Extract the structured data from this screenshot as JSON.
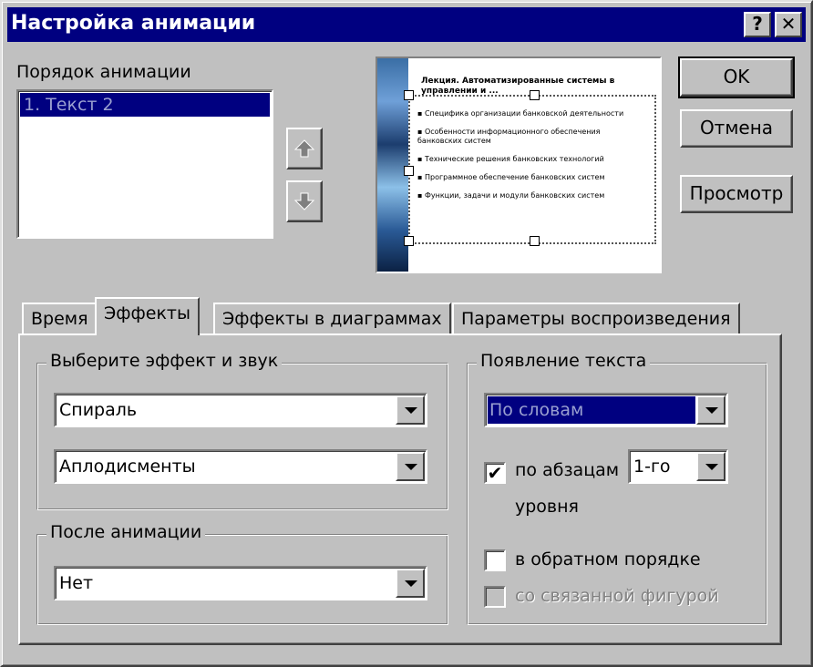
{
  "window": {
    "title": "Настройка анимации",
    "help_label": "?",
    "close_label": "✕"
  },
  "buttons": {
    "ok": "OK",
    "cancel": "Отмена",
    "preview": "Просмотр"
  },
  "order": {
    "label": "Порядок анимации",
    "items": [
      "1. Текст 2"
    ]
  },
  "slide_preview": {
    "title": "Лекция. Автоматизированные системы в управлении и ...",
    "bullets": [
      "Специфика организации банковской деятельности",
      "Особенности информационного обеспечения банковских систем",
      "Технические решения банковских технологий",
      "Программное обеспечение банковских систем",
      "Функции, задачи и модули банковских систем"
    ]
  },
  "tabs": [
    {
      "label": "Время",
      "active": false
    },
    {
      "label": "Эффекты",
      "active": true
    },
    {
      "label": "Эффекты в диаграммах",
      "active": false
    },
    {
      "label": "Параметры воспроизведения",
      "active": false
    }
  ],
  "effects": {
    "group_title": "Выберите эффект и звук",
    "effect_value": "Спираль",
    "sound_value": "Аплодисменты"
  },
  "after": {
    "group_title": "После анимации",
    "value": "Нет"
  },
  "text_appearance": {
    "group_title": "Появление текста",
    "mode_value": "По словам",
    "by_paragraph_label": "по абзацам",
    "level_value": "1-го",
    "level_suffix": "уровня",
    "by_paragraph_checked": true,
    "reverse_label": "в обратном порядке",
    "reverse_checked": false,
    "linked_label": "со связанной фигурой",
    "linked_enabled": false
  }
}
